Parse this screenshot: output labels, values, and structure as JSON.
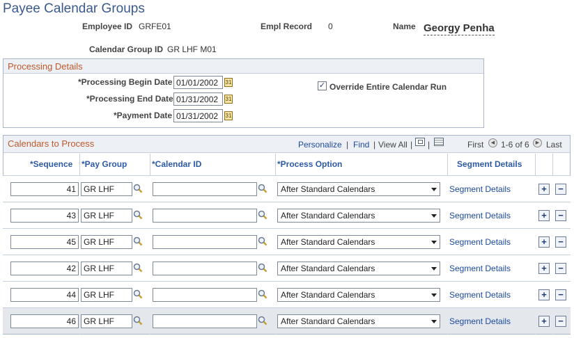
{
  "page": {
    "title": "Payee Calendar Groups"
  },
  "header": {
    "employee_id_label": "Employee ID",
    "employee_id": "GRFE01",
    "empl_record_label": "Empl Record",
    "empl_record": "0",
    "name_label": "Name",
    "name": "Georgy Penha",
    "calendar_group_id_label": "Calendar Group ID",
    "calendar_group_id": "GR LHF M01"
  },
  "processing": {
    "title": "Processing Details",
    "begin_label": "*Processing Begin Date",
    "begin_value": "01/01/2002",
    "end_label": "*Processing End Date",
    "end_value": "01/31/2002",
    "payment_label": "*Payment Date",
    "payment_value": "01/31/2002",
    "override_label": "Override Entire Calendar Run",
    "override_checked": true
  },
  "grid": {
    "title": "Calendars to Process",
    "personalize": "Personalize",
    "find": "Find",
    "view_all": "View All",
    "first": "First",
    "range": "1-6 of 6",
    "last": "Last",
    "columns": {
      "sequence": "*Sequence",
      "pay_group": "*Pay Group",
      "calendar_id": "*Calendar ID",
      "process_option": "*Process Option",
      "segment_details": "Segment Details"
    },
    "rows": [
      {
        "sequence": "41",
        "pay_group": "GR LHF",
        "calendar_id": "",
        "process_option": "After Standard Calendars",
        "segment_link": "Segment Details"
      },
      {
        "sequence": "43",
        "pay_group": "GR LHF",
        "calendar_id": "",
        "process_option": "After Standard Calendars",
        "segment_link": "Segment Details"
      },
      {
        "sequence": "45",
        "pay_group": "GR LHF",
        "calendar_id": "",
        "process_option": "After Standard Calendars",
        "segment_link": "Segment Details"
      },
      {
        "sequence": "42",
        "pay_group": "GR LHF",
        "calendar_id": "",
        "process_option": "After Standard Calendars",
        "segment_link": "Segment Details"
      },
      {
        "sequence": "44",
        "pay_group": "GR LHF",
        "calendar_id": "",
        "process_option": "After Standard Calendars",
        "segment_link": "Segment Details"
      },
      {
        "sequence": "46",
        "pay_group": "GR LHF",
        "calendar_id": "",
        "process_option": "After Standard Calendars",
        "segment_link": "Segment Details"
      }
    ],
    "add_symbol": "+",
    "delete_symbol": "−"
  },
  "icons": {
    "lookup": "magnifier-icon",
    "calendar": "calendar-icon",
    "zoom": "zoom-icon",
    "download": "download-icon",
    "prev": "arrow-left-icon",
    "next": "arrow-right-icon"
  },
  "colors": {
    "title_blue": "#3a5a8c",
    "section_orange": "#c0582a",
    "link_blue": "#1c4aa0",
    "header_bg": "#edf1f6"
  }
}
